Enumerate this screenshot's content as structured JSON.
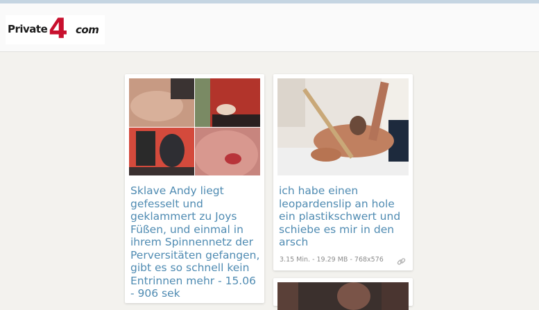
{
  "header": {
    "logo": {
      "part1": "Private",
      "part2": "4",
      "part3": "com"
    }
  },
  "cards": [
    {
      "title": "Sklave Andy liegt gefesselt und geklammert zu Joys Füßen, und einmal in ihrem Spinnennetz der Perversitäten gefangen, gibt es so schnell kein Entrinnen mehr - 15.06 - 906 sek"
    },
    {
      "title": "ich habe einen leopardenslip an hole ein plastikschwert und schiebe es mir in den arsch",
      "meta": "3.15 Min. - 19.29 MB - 768x576"
    }
  ]
}
